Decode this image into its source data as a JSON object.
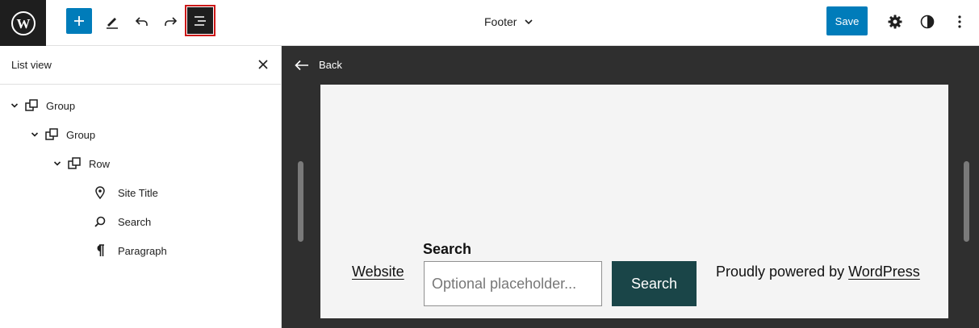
{
  "toolbar": {
    "document_title": "Footer",
    "save_label": "Save"
  },
  "sidebar": {
    "title": "List view",
    "items": [
      {
        "label": "Group",
        "icon": "group-icon",
        "expanded": true
      },
      {
        "label": "Group",
        "icon": "group-icon",
        "expanded": true
      },
      {
        "label": "Row",
        "icon": "row-icon",
        "expanded": true
      },
      {
        "label": "Site Title",
        "icon": "map-pin-icon"
      },
      {
        "label": "Search",
        "icon": "search-icon"
      },
      {
        "label": "Paragraph",
        "icon": "paragraph-icon"
      }
    ]
  },
  "canvas": {
    "back_label": "Back",
    "site_title": "Website",
    "search_label": "Search",
    "search_placeholder": "Optional placeholder...",
    "search_button": "Search",
    "powered_prefix": "Proudly powered by",
    "powered_link": "WordPress"
  },
  "colors": {
    "accent": "#007cba",
    "highlight_border": "#cc1818",
    "search_button_bg": "#1a4548",
    "canvas_bg": "#2f2f2f"
  }
}
